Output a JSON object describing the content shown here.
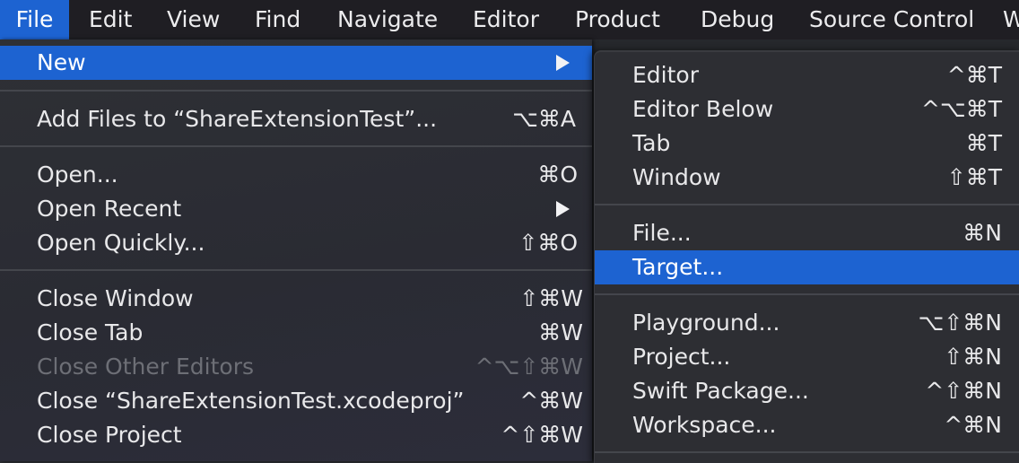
{
  "menubar": {
    "items": [
      "File",
      "Edit",
      "View",
      "Find",
      "Navigate",
      "Editor",
      "Product",
      "Debug",
      "Source Control",
      "W"
    ]
  },
  "file_menu": {
    "new": {
      "label": "New"
    },
    "add_files": {
      "label": "Add Files to “ShareExtensionTest”...",
      "shortcut": "⌥⌘A"
    },
    "open": {
      "label": "Open...",
      "shortcut": "⌘O"
    },
    "open_recent": {
      "label": "Open Recent"
    },
    "open_quickly": {
      "label": "Open Quickly...",
      "shortcut": "⇧⌘O"
    },
    "close_window": {
      "label": "Close Window",
      "shortcut": "⇧⌘W"
    },
    "close_tab": {
      "label": "Close Tab",
      "shortcut": "⌘W"
    },
    "close_other_editors": {
      "label": "Close Other Editors",
      "shortcut": "^⌥⇧⌘W"
    },
    "close_xcodeproj": {
      "label": "Close “ShareExtensionTest.xcodeproj”",
      "shortcut": "^⌘W"
    },
    "close_project": {
      "label": "Close Project",
      "shortcut": "^⇧⌘W"
    }
  },
  "new_submenu": {
    "editor": {
      "label": "Editor",
      "shortcut": "^⌘T"
    },
    "editor_below": {
      "label": "Editor Below",
      "shortcut": "^⌥⌘T"
    },
    "tab": {
      "label": "Tab",
      "shortcut": "⌘T"
    },
    "window": {
      "label": "Window",
      "shortcut": "⇧⌘T"
    },
    "file": {
      "label": "File...",
      "shortcut": "⌘N"
    },
    "target": {
      "label": "Target..."
    },
    "playground": {
      "label": "Playground...",
      "shortcut": "⌥⇧⌘N"
    },
    "project": {
      "label": "Project...",
      "shortcut": "⇧⌘N"
    },
    "swift_package": {
      "label": "Swift Package...",
      "shortcut": "^⇧⌘N"
    },
    "workspace": {
      "label": "Workspace...",
      "shortcut": "^⌘N"
    }
  },
  "colors": {
    "highlight": "#1d63d1",
    "menu_bg": "#2d2e33",
    "disabled_text": "#6d6f76"
  }
}
